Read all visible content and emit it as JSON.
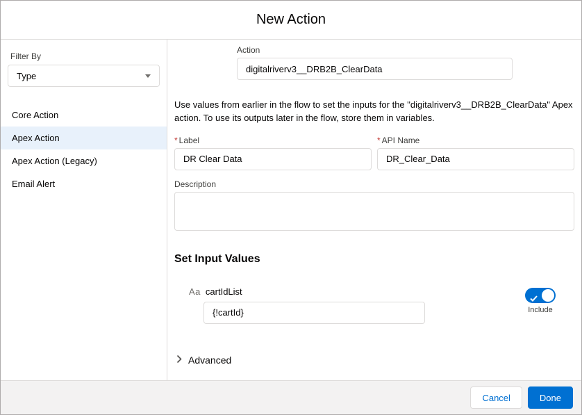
{
  "modal": {
    "title": "New Action"
  },
  "sidebar": {
    "filter_by_label": "Filter By",
    "type_dropdown_value": "Type",
    "items": [
      {
        "label": "Core Action"
      },
      {
        "label": "Apex Action"
      },
      {
        "label": "Apex Action (Legacy)"
      },
      {
        "label": "Email Alert"
      }
    ]
  },
  "form": {
    "action_label": "Action",
    "action_value": "digitalriverv3__DRB2B_ClearData",
    "intro_text": "Use values from earlier in the flow to set the inputs for the \"digitalriverv3__DRB2B_ClearData\" Apex action. To use its outputs later in the flow, store them in variables.",
    "required_marker": "*",
    "label_field": {
      "label": "Label",
      "value": "DR Clear Data"
    },
    "api_name_field": {
      "label": "API Name",
      "value": "DR_Clear_Data"
    },
    "description_field": {
      "label": "Description",
      "value": ""
    },
    "set_input_values_heading": "Set Input Values",
    "cart_id_param": {
      "type_icon": "Aa",
      "label": "cartIdList",
      "value": "{!cartId}"
    },
    "include_toggle": {
      "label": "Include",
      "checked": true
    },
    "advanced_label": "Advanced"
  },
  "footer": {
    "cancel_label": "Cancel",
    "done_label": "Done"
  },
  "colors": {
    "accent": "#0070d2",
    "selected_item_bg": "#e8f1fb",
    "border": "#dddbda",
    "footer_bg": "#f3f2f2",
    "required_red": "#c23934"
  }
}
